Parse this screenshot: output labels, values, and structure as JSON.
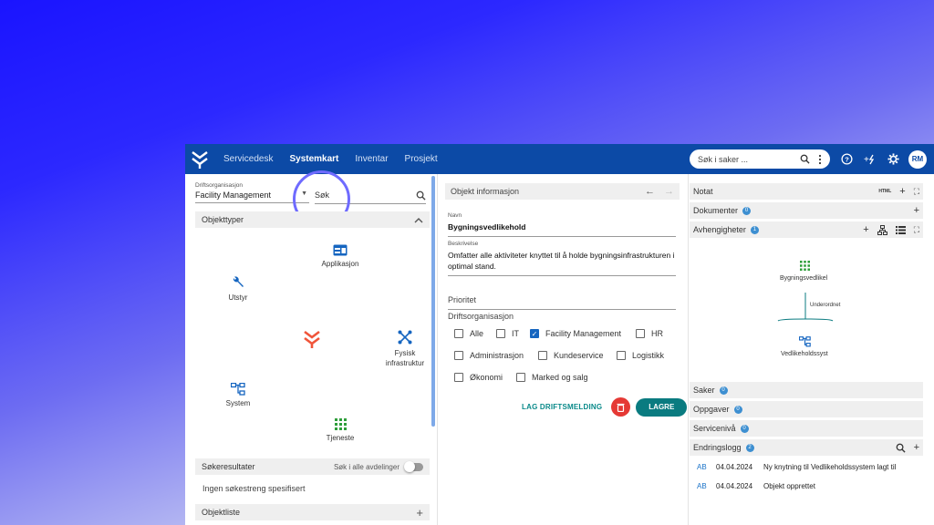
{
  "topbar": {
    "nav": [
      "Servicedesk",
      "Systemkart",
      "Inventar",
      "Prosjekt"
    ],
    "active": "Systemkart",
    "search_placeholder": "Søk i saker ...",
    "avatar": "RM"
  },
  "left": {
    "org_label": "Driftsorganisasjon",
    "org_value": "Facility Management",
    "search_placeholder": "Søk",
    "objecttypes_title": "Objekttyper",
    "objecttypes": [
      {
        "label": "Applikasjon",
        "icon": "application-icon"
      },
      {
        "label": "Utstyr",
        "icon": "wrench-icon"
      },
      {
        "label": "Fysisk infrastruktur",
        "icon": "network-icon"
      },
      {
        "label": "System",
        "icon": "system-icon"
      },
      {
        "label": "Tjeneste",
        "icon": "grid-icon"
      }
    ],
    "results_title": "Søkeresultater",
    "search_all": "Søk i alle avdelinger",
    "no_results": "Ingen søkestreng spesifisert",
    "objectlist_title": "Objektliste"
  },
  "middle": {
    "title": "Objekt informasjon",
    "name_label": "Navn",
    "name_value": "Bygningsvedlikehold",
    "desc_label": "Beskrivelse",
    "desc_value": "Omfatter alle aktiviteter knyttet til å holde bygningsinfrastrukturen i optimal stand.",
    "priority_label": "Prioritet",
    "org_label": "Driftsorganisasjon",
    "checkboxes": [
      {
        "label": "Alle",
        "checked": false
      },
      {
        "label": "IT",
        "checked": false
      },
      {
        "label": "Facility Management",
        "checked": true
      },
      {
        "label": "HR",
        "checked": false
      },
      {
        "label": "Administrasjon",
        "checked": false
      },
      {
        "label": "Kundeservice",
        "checked": false
      },
      {
        "label": "Logistikk",
        "checked": false
      },
      {
        "label": "Økonomi",
        "checked": false
      },
      {
        "label": "Marked og salg",
        "checked": false
      }
    ],
    "report_btn": "LAG DRIFTSMELDING",
    "save_btn": "LAGRE"
  },
  "right": {
    "notat": "Notat",
    "html_tag": "HTML",
    "dokumenter": "Dokumenter",
    "dokumenter_count": "0",
    "avhengigheter": "Avhengigheter",
    "avhengigheter_count": "1",
    "graph": {
      "top": "Bygningsvedlikel",
      "relation": "Underordnet",
      "bottom": "Vedlikeholdssyst"
    },
    "saker": "Saker",
    "saker_count": "0",
    "oppgaver": "Oppgaver",
    "oppgaver_count": "0",
    "serviceniva": "Servicenivå",
    "serviceniva_count": "0",
    "endringslogg": "Endringslogg",
    "endringslogg_count": "2",
    "log": [
      {
        "initials": "AB",
        "date": "04.04.2024",
        "text": "Ny knytning til Vedlikeholdssystem lagt til"
      },
      {
        "initials": "AB",
        "date": "04.04.2024",
        "text": "Objekt opprettet"
      }
    ]
  },
  "colors": {
    "topbar": "#0c4aa6",
    "accent": "#0a7b80",
    "danger": "#e53935",
    "orange": "#f0553a",
    "blue_icon": "#1565c0",
    "green_icon": "#2e9d3a"
  }
}
